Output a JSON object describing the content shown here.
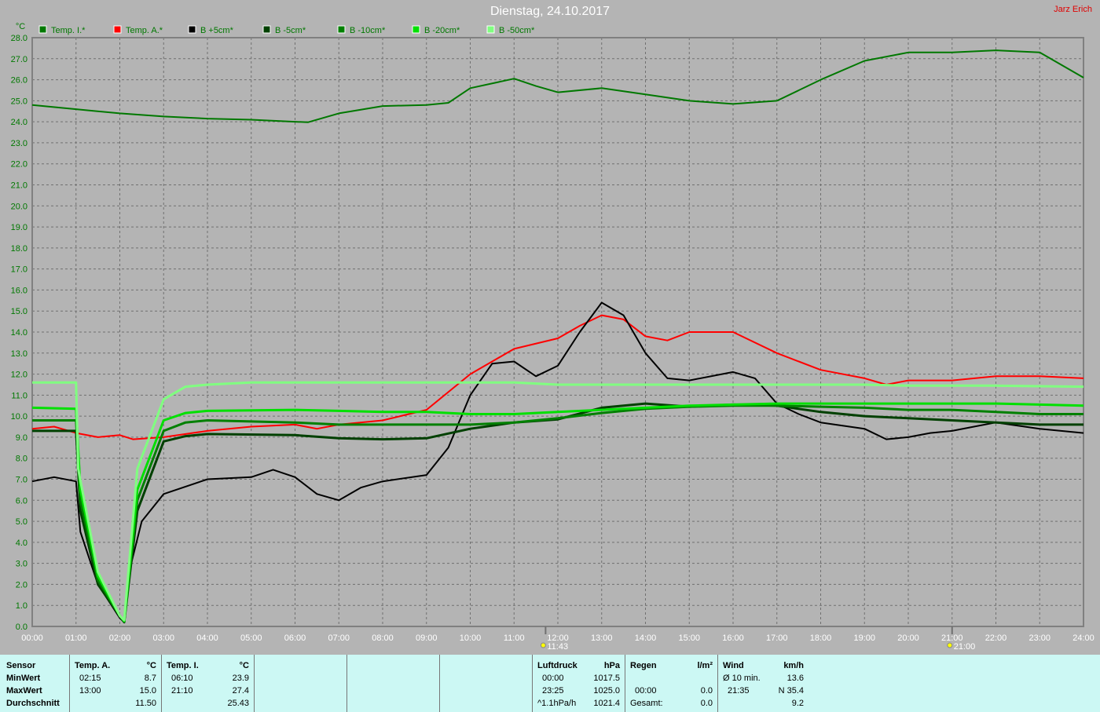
{
  "header": {
    "title": "Dienstag, 24.10.2017",
    "author": "Jarz Erich"
  },
  "chart_data": {
    "type": "line",
    "title": "Dienstag, 24.10.2017",
    "ylabel": "°C",
    "xlabel": "",
    "ylim": [
      0,
      28
    ],
    "xlim": [
      0,
      24
    ],
    "grid": true,
    "legend": "top-left",
    "yticks": [
      "0.0",
      "1.0",
      "2.0",
      "3.0",
      "4.0",
      "5.0",
      "6.0",
      "7.0",
      "8.0",
      "9.0",
      "10.0",
      "11.0",
      "12.0",
      "13.0",
      "14.0",
      "15.0",
      "16.0",
      "17.0",
      "18.0",
      "19.0",
      "20.0",
      "21.0",
      "22.0",
      "23.0",
      "24.0",
      "25.0",
      "26.0",
      "27.0",
      "28.0"
    ],
    "xticks": [
      "00:00",
      "01:00",
      "02:00",
      "03:00",
      "04:00",
      "05:00",
      "06:00",
      "07:00",
      "08:00",
      "09:00",
      "10:00",
      "11:00",
      "12:00",
      "13:00",
      "14:00",
      "15:00",
      "16:00",
      "17:00",
      "18:00",
      "19:00",
      "20:00",
      "21:00",
      "22:00",
      "23:00",
      "24:00"
    ],
    "annotations": [
      {
        "x": 11.72,
        "text": "11:43",
        "icon": "sun-moon-icon"
      },
      {
        "x": 21.0,
        "text": "21:00",
        "icon": "sun-moon-icon"
      }
    ],
    "series": [
      {
        "name": "Temp. I.*",
        "color": "#007800",
        "width": 2,
        "points": [
          [
            0,
            24.8
          ],
          [
            1,
            24.6
          ],
          [
            2,
            24.4
          ],
          [
            3,
            24.25
          ],
          [
            4,
            24.15
          ],
          [
            5,
            24.1
          ],
          [
            6,
            24.0
          ],
          [
            6.3,
            23.98
          ],
          [
            7,
            24.4
          ],
          [
            8,
            24.75
          ],
          [
            9,
            24.8
          ],
          [
            9.5,
            24.9
          ],
          [
            10,
            25.6
          ],
          [
            11,
            26.05
          ],
          [
            11.5,
            25.7
          ],
          [
            12,
            25.4
          ],
          [
            13,
            25.6
          ],
          [
            14,
            25.3
          ],
          [
            15,
            25.0
          ],
          [
            16,
            24.85
          ],
          [
            17,
            25.0
          ],
          [
            18,
            26.0
          ],
          [
            19,
            26.9
          ],
          [
            20,
            27.3
          ],
          [
            21,
            27.3
          ],
          [
            22,
            27.4
          ],
          [
            23,
            27.3
          ],
          [
            24,
            26.1
          ]
        ]
      },
      {
        "name": "Temp. A.*",
        "color": "#ff0000",
        "width": 2,
        "points": [
          [
            0,
            9.4
          ],
          [
            0.5,
            9.5
          ],
          [
            1,
            9.2
          ],
          [
            1.5,
            9.0
          ],
          [
            2,
            9.1
          ],
          [
            2.3,
            8.9
          ],
          [
            3,
            9.0
          ],
          [
            4,
            9.3
          ],
          [
            5,
            9.5
          ],
          [
            6,
            9.6
          ],
          [
            6.5,
            9.4
          ],
          [
            7,
            9.6
          ],
          [
            8,
            9.8
          ],
          [
            9,
            10.3
          ],
          [
            10,
            12.0
          ],
          [
            11,
            13.2
          ],
          [
            12,
            13.7
          ],
          [
            12.5,
            14.3
          ],
          [
            13,
            14.8
          ],
          [
            13.5,
            14.6
          ],
          [
            14,
            13.8
          ],
          [
            14.5,
            13.6
          ],
          [
            15,
            14.0
          ],
          [
            16,
            14.0
          ],
          [
            17,
            13.0
          ],
          [
            18,
            12.2
          ],
          [
            19,
            11.8
          ],
          [
            19.5,
            11.5
          ],
          [
            20,
            11.7
          ],
          [
            21,
            11.7
          ],
          [
            22,
            11.9
          ],
          [
            23,
            11.9
          ],
          [
            24,
            11.8
          ]
        ]
      },
      {
        "name": "B +5cm*",
        "color": "#000000",
        "width": 2,
        "points": [
          [
            0,
            6.9
          ],
          [
            0.5,
            7.1
          ],
          [
            1,
            6.9
          ],
          [
            1.1,
            4.5
          ],
          [
            1.5,
            2.0
          ],
          [
            2,
            0.4
          ],
          [
            2.1,
            0.2
          ],
          [
            2.2,
            2.5
          ],
          [
            2.5,
            5.0
          ],
          [
            3,
            6.3
          ],
          [
            4,
            7.0
          ],
          [
            5,
            7.1
          ],
          [
            5.5,
            7.45
          ],
          [
            6,
            7.1
          ],
          [
            6.5,
            6.3
          ],
          [
            7,
            6.0
          ],
          [
            7.5,
            6.6
          ],
          [
            8,
            6.9
          ],
          [
            9,
            7.2
          ],
          [
            9.5,
            8.5
          ],
          [
            10,
            11.0
          ],
          [
            10.5,
            12.5
          ],
          [
            11,
            12.6
          ],
          [
            11.5,
            11.9
          ],
          [
            12,
            12.4
          ],
          [
            12.5,
            14.0
          ],
          [
            13,
            15.4
          ],
          [
            13.5,
            14.8
          ],
          [
            14,
            13.0
          ],
          [
            14.5,
            11.8
          ],
          [
            15,
            11.7
          ],
          [
            16,
            12.1
          ],
          [
            16.5,
            11.8
          ],
          [
            17,
            10.6
          ],
          [
            17.5,
            10.1
          ],
          [
            18,
            9.7
          ],
          [
            19,
            9.4
          ],
          [
            19.5,
            8.9
          ],
          [
            20,
            9.0
          ],
          [
            20.5,
            9.2
          ],
          [
            21,
            9.3
          ],
          [
            21.5,
            9.5
          ],
          [
            22,
            9.7
          ],
          [
            23,
            9.4
          ],
          [
            24,
            9.2
          ]
        ]
      },
      {
        "name": "B -5cm*",
        "color": "#004000",
        "width": 3,
        "points": [
          [
            0,
            9.3
          ],
          [
            1,
            9.3
          ],
          [
            1.1,
            5.5
          ],
          [
            1.5,
            2.0
          ],
          [
            2,
            0.5
          ],
          [
            2.1,
            0.2
          ],
          [
            2.4,
            5.5
          ],
          [
            3,
            8.8
          ],
          [
            3.5,
            9.05
          ],
          [
            4,
            9.15
          ],
          [
            6,
            9.1
          ],
          [
            7,
            8.95
          ],
          [
            8,
            8.9
          ],
          [
            9,
            8.95
          ],
          [
            10,
            9.4
          ],
          [
            11,
            9.7
          ],
          [
            12,
            9.85
          ],
          [
            13,
            10.4
          ],
          [
            14,
            10.6
          ],
          [
            15,
            10.45
          ],
          [
            16,
            10.55
          ],
          [
            17,
            10.5
          ],
          [
            18,
            10.2
          ],
          [
            19,
            10.0
          ],
          [
            20,
            9.9
          ],
          [
            21,
            9.8
          ],
          [
            22,
            9.7
          ],
          [
            23,
            9.6
          ],
          [
            24,
            9.6
          ]
        ]
      },
      {
        "name": "B -10cm*",
        "color": "#008000",
        "width": 3,
        "points": [
          [
            0,
            9.8
          ],
          [
            1,
            9.8
          ],
          [
            1.1,
            6.0
          ],
          [
            1.5,
            2.2
          ],
          [
            2,
            0.5
          ],
          [
            2.1,
            0.25
          ],
          [
            2.4,
            6.0
          ],
          [
            3,
            9.3
          ],
          [
            3.5,
            9.7
          ],
          [
            4,
            9.8
          ],
          [
            6,
            9.7
          ],
          [
            7,
            9.6
          ],
          [
            9,
            9.6
          ],
          [
            10,
            9.6
          ],
          [
            11,
            9.7
          ],
          [
            12,
            9.9
          ],
          [
            13,
            10.15
          ],
          [
            14,
            10.35
          ],
          [
            15,
            10.45
          ],
          [
            16,
            10.5
          ],
          [
            17,
            10.5
          ],
          [
            18,
            10.45
          ],
          [
            19,
            10.4
          ],
          [
            20,
            10.3
          ],
          [
            21,
            10.3
          ],
          [
            22,
            10.2
          ],
          [
            23,
            10.1
          ],
          [
            24,
            10.1
          ]
        ]
      },
      {
        "name": "B -20cm*",
        "color": "#00e000",
        "width": 3,
        "points": [
          [
            0,
            10.4
          ],
          [
            1,
            10.35
          ],
          [
            1.1,
            6.5
          ],
          [
            1.5,
            2.4
          ],
          [
            2,
            0.5
          ],
          [
            2.1,
            0.25
          ],
          [
            2.4,
            6.5
          ],
          [
            3,
            9.8
          ],
          [
            3.5,
            10.15
          ],
          [
            4,
            10.25
          ],
          [
            6,
            10.3
          ],
          [
            7,
            10.25
          ],
          [
            8,
            10.2
          ],
          [
            9,
            10.2
          ],
          [
            10,
            10.1
          ],
          [
            11,
            10.1
          ],
          [
            12,
            10.2
          ],
          [
            13,
            10.3
          ],
          [
            14,
            10.4
          ],
          [
            15,
            10.5
          ],
          [
            16,
            10.55
          ],
          [
            17,
            10.6
          ],
          [
            18,
            10.6
          ],
          [
            19,
            10.6
          ],
          [
            20,
            10.6
          ],
          [
            21,
            10.6
          ],
          [
            22,
            10.6
          ],
          [
            23,
            10.55
          ],
          [
            24,
            10.5
          ]
        ]
      },
      {
        "name": "B -50cm*",
        "color": "#80ff80",
        "width": 3,
        "points": [
          [
            0,
            11.6
          ],
          [
            1,
            11.6
          ],
          [
            1.05,
            7.5
          ],
          [
            1.5,
            2.6
          ],
          [
            2,
            0.5
          ],
          [
            2.1,
            0.3
          ],
          [
            2.4,
            7.5
          ],
          [
            3,
            10.8
          ],
          [
            3.5,
            11.4
          ],
          [
            4,
            11.5
          ],
          [
            5,
            11.6
          ],
          [
            11,
            11.6
          ],
          [
            12,
            11.5
          ],
          [
            19,
            11.5
          ],
          [
            20,
            11.45
          ],
          [
            22,
            11.45
          ],
          [
            24,
            11.4
          ]
        ]
      }
    ]
  },
  "table": {
    "sensor": {
      "h": "Sensor",
      "r1": "MinWert",
      "r2": "MaxWert",
      "r3": "Durchschnitt"
    },
    "tempA": {
      "h": "Temp. A.",
      "u": "°C",
      "t1": "02:15",
      "v1": "8.7",
      "t2": "13:00",
      "v2": "15.0",
      "v3": "11.50"
    },
    "tempI": {
      "h": "Temp. I.",
      "u": "°C",
      "t1": "06:10",
      "v1": "23.9",
      "t2": "21:10",
      "v2": "27.4",
      "v3": "25.43"
    },
    "luft": {
      "h": "Luftdruck",
      "u": "hPa",
      "t1": "00:00",
      "v1": "1017.5",
      "t2": "23:25",
      "v2": "1025.0",
      "t3": "^1.1hPa/h",
      "v3": "1021.4"
    },
    "regen": {
      "h": "Regen",
      "u": "l/m²",
      "t2": "00:00",
      "v2": "0.0",
      "t3": "Gesamt:",
      "v3": "0.0"
    },
    "wind": {
      "h": "Wind",
      "u": "km/h",
      "t1": "Ø 10 min.",
      "v1": "13.6",
      "t2": "21:35",
      "v2": "N 35.4",
      "v3": "9.2"
    }
  }
}
